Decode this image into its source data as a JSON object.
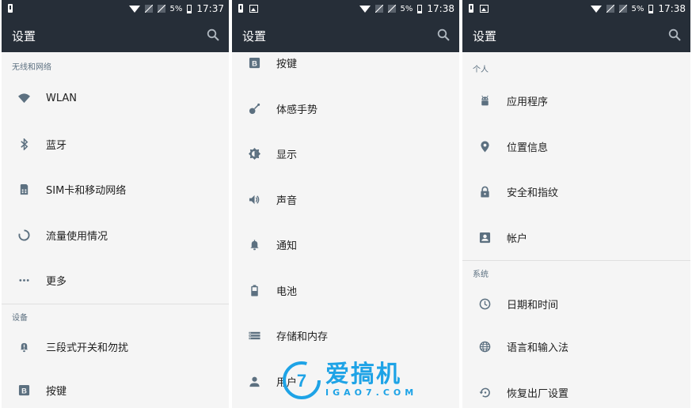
{
  "panels": [
    {
      "status": {
        "time": "17:37",
        "battery": "5%"
      },
      "title": "设置",
      "sections": [
        {
          "header": "无线和网络",
          "items": [
            {
              "label": "WLAN",
              "icon": "wifi-icon"
            },
            {
              "label": "蓝牙",
              "icon": "bluetooth-icon"
            },
            {
              "label": "SIM卡和移动网络",
              "icon": "sim-card-icon"
            },
            {
              "label": "流量使用情况",
              "icon": "data-usage-icon"
            },
            {
              "label": "更多",
              "icon": "more-icon"
            }
          ]
        },
        {
          "header": "设备",
          "items": [
            {
              "label": "三段式开关和勿扰",
              "icon": "alert-slider-icon"
            },
            {
              "label": "按键",
              "icon": "buttons-icon"
            }
          ]
        }
      ]
    },
    {
      "status": {
        "time": "17:38",
        "battery": "5%"
      },
      "title": "设置",
      "items": [
        {
          "label": "按键",
          "icon": "buttons-icon"
        },
        {
          "label": "体感手势",
          "icon": "gestures-icon"
        },
        {
          "label": "显示",
          "icon": "display-icon"
        },
        {
          "label": "声音",
          "icon": "volume-icon"
        },
        {
          "label": "通知",
          "icon": "bell-icon"
        },
        {
          "label": "电池",
          "icon": "battery-icon"
        },
        {
          "label": "存储和内存",
          "icon": "storage-icon"
        },
        {
          "label": "用户",
          "icon": "user-icon"
        }
      ]
    },
    {
      "status": {
        "time": "17:38",
        "battery": "5%"
      },
      "title": "设置",
      "sections": [
        {
          "header": "个人",
          "items": [
            {
              "label": "应用程序",
              "icon": "android-icon"
            },
            {
              "label": "位置信息",
              "icon": "location-icon"
            },
            {
              "label": "安全和指纹",
              "icon": "lock-icon"
            },
            {
              "label": "帐户",
              "icon": "account-icon"
            }
          ]
        },
        {
          "header": "系统",
          "items": [
            {
              "label": "日期和时间",
              "icon": "clock-icon"
            },
            {
              "label": "语言和输入法",
              "icon": "globe-icon"
            },
            {
              "label": "恢复出厂设置",
              "icon": "restore-icon"
            }
          ]
        }
      ]
    }
  ],
  "watermark": {
    "main": "爱搞机",
    "sub": "IGAO7.COM"
  },
  "colors": {
    "appbar": "#262e38",
    "icon": "#5c7080",
    "background": "#f5f5f5"
  }
}
